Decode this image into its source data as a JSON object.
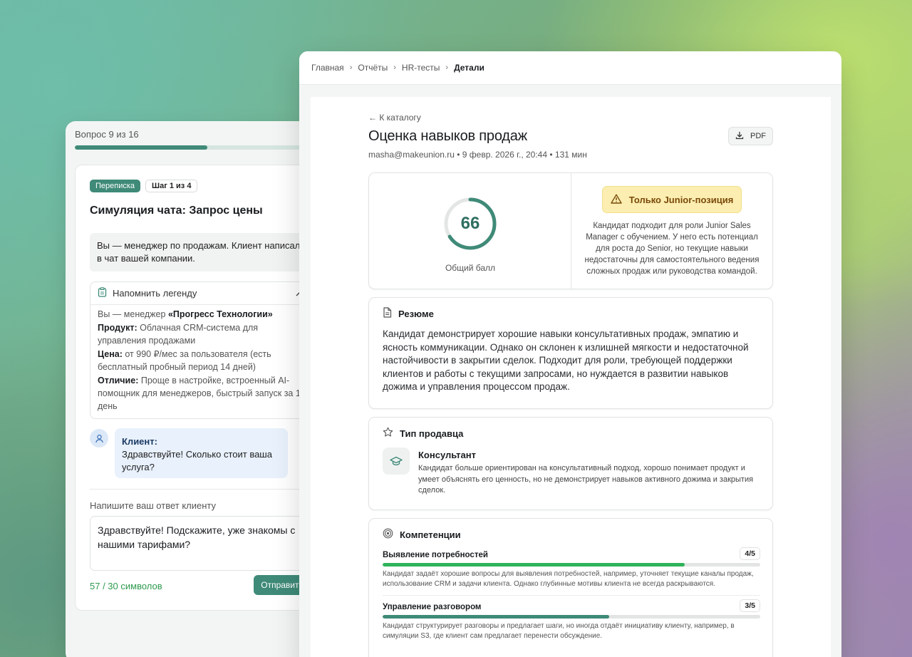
{
  "quiz": {
    "counter": "Вопрос 9 из 16",
    "progress": 0.5625,
    "badge_type": "Переписка",
    "badge_step": "Шаг 1 из 4",
    "title": "Симуляция чата: Запрос цены",
    "intro": "Вы — менеджер по продажам. Клиент написал в чат вашей компании.",
    "legend": {
      "toggle_label": "Напомнить легенду",
      "line1_prefix": "Вы — менеджер ",
      "line1_company": "«Прогресс Технологии»",
      "product_label": "Продукт:",
      "product_value": " Облачная CRM-система для управления продажами",
      "price_label": "Цена:",
      "price_value": " от 990 ₽/мес за пользователя (есть бесплатный пробный период 14 дней)",
      "diff_label": "Отличие:",
      "diff_value": " Проще в настройке, встроенный AI-помощник для менеджеров, быстрый запуск за 1 день"
    },
    "client": {
      "who": "Клиент:",
      "message": "Здравствуйте! Сколько стоит ваша услуга?"
    },
    "reply_label": "Напишите ваш ответ клиенту",
    "reply_value": "Здравствуйте! Подскажите, уже знакомы с нашими тарифами?",
    "char_count": "57 / 30 символов",
    "send_label": "Отправить"
  },
  "breadcrumb": {
    "items": [
      "Главная",
      "Отчёты",
      "HR-тесты"
    ],
    "current": "Детали"
  },
  "report": {
    "back_label": "← К каталогу",
    "title": "Оценка навыков продаж",
    "meta": "masha@makeunion.ru • 9 февр. 2026 г., 20:44 • 131 мин",
    "pdf_label": "PDF",
    "score": {
      "value": "66",
      "max": 100,
      "label": "Общий балл"
    },
    "verdict": {
      "label": "Только Junior-позиция",
      "text": "Кандидат подходит для роли Junior Sales Manager с обучением. У него есть потенциал для роста до Senior, но текущие навыки недостаточны для самостоятельного ведения сложных продаж или руководства командой."
    },
    "resume": {
      "title": "Резюме",
      "text": "Кандидат демонстрирует хорошие навыки консультативных продаж, эмпатию и ясность коммуникации. Однако он склонен к излишней мягкости и недостаточной настойчивости в закрытии сделок. Подходит для роли, требующей поддержки клиентов и работы с текущими запросами, но нуждается в развитии навыков дожима и управления процессом продаж."
    },
    "seller_type": {
      "title": "Тип продавца",
      "name": "Консультант",
      "desc": "Кандидат больше ориентирован на консультативный подход, хорошо понимает продукт и умеет объяснять его ценность, но не демонстрирует навыков активного дожима и закрытия сделок."
    },
    "competencies": {
      "title": "Компетенции",
      "items": [
        {
          "name": "Выявление потребностей",
          "score": "4/5",
          "level": 0.8,
          "color": "#2fb35a",
          "desc": "Кандидат задаёт хорошие вопросы для выявления потребностей, например, уточняет текущие каналы продаж, использование CRM и задачи клиента. Однако глубинные мотивы клиента не всегда раскрываются."
        },
        {
          "name": "Управление разговором",
          "score": "3/5",
          "level": 0.6,
          "color": "#3f8a78",
          "desc": "Кандидат структурирует разговоры и предлагает шаги, но иногда отдаёт инициативу клиенту, например, в симуляции S3, где клиент сам предлагает перенести обсуждение."
        }
      ]
    }
  },
  "colors": {
    "accent": "#3f8a78",
    "ring_track": "#e4e6e5",
    "verdict_bg": "#fbeeb0"
  }
}
